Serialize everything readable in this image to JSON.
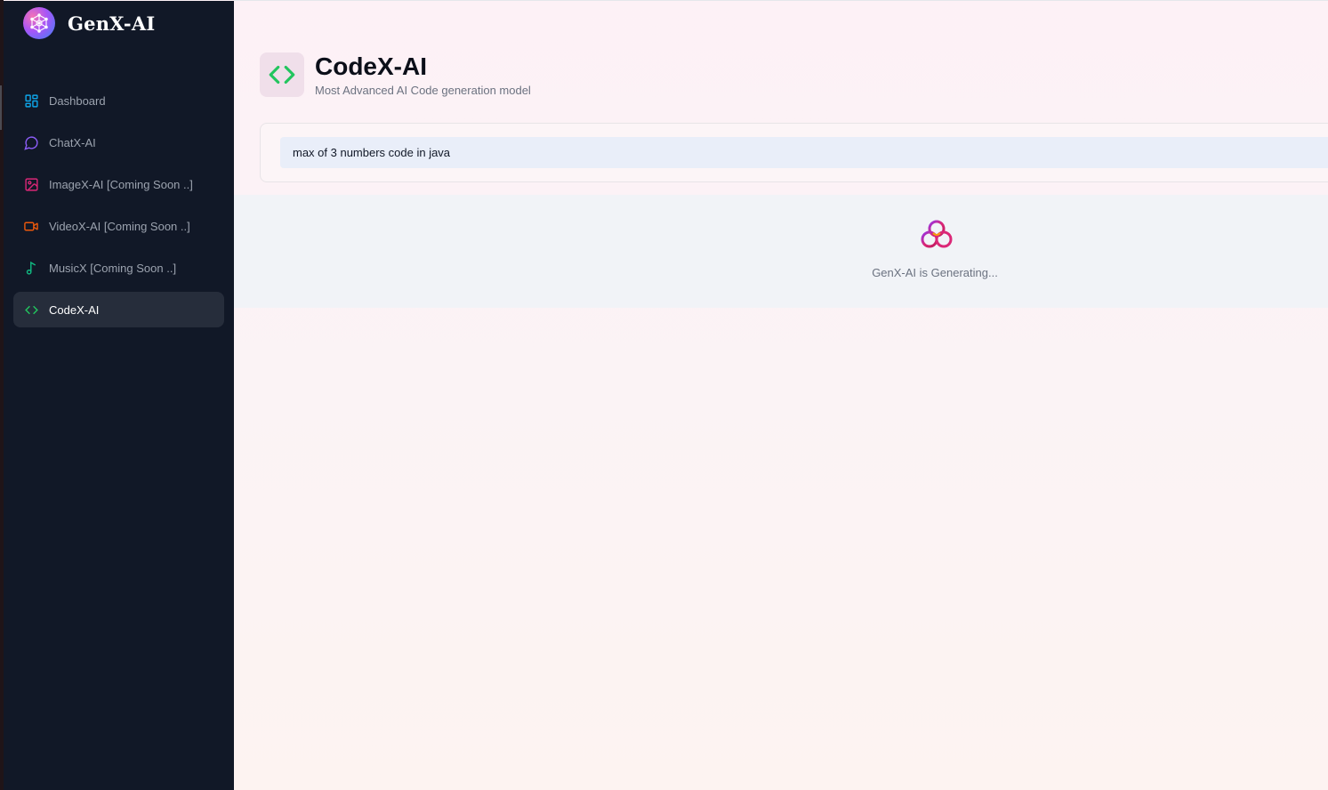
{
  "brand": {
    "name": "GenX-AI",
    "logo": "genx-network-logo"
  },
  "sidebar": {
    "items": [
      {
        "label": "Dashboard",
        "icon": "dashboard-grid-icon",
        "color": "#0ea5e9",
        "active": false
      },
      {
        "label": "ChatX-AI",
        "icon": "chat-bubble-icon",
        "color": "#8b5cf6",
        "active": false
      },
      {
        "label": "ImageX-AI [Coming Soon ..]",
        "icon": "image-icon",
        "color": "#db2777",
        "active": false
      },
      {
        "label": "VideoX-AI [Coming Soon ..]",
        "icon": "video-icon",
        "color": "#ea580c",
        "active": false
      },
      {
        "label": "MusicX [Coming Soon ..]",
        "icon": "music-note-icon",
        "color": "#10b981",
        "active": false
      },
      {
        "label": "CodeX-AI",
        "icon": "code-brackets-icon",
        "color": "#22c55e",
        "active": true
      }
    ]
  },
  "header": {
    "title": "CodeX-AI",
    "subtitle": "Most Advanced AI Code generation model",
    "icon": "code-brackets-icon",
    "icon_color": "#22c55e"
  },
  "prompt": {
    "value": "max of 3 numbers code in java"
  },
  "loader": {
    "text": "GenX-AI is Generating...",
    "icon": "genx-loader-knot-icon"
  }
}
